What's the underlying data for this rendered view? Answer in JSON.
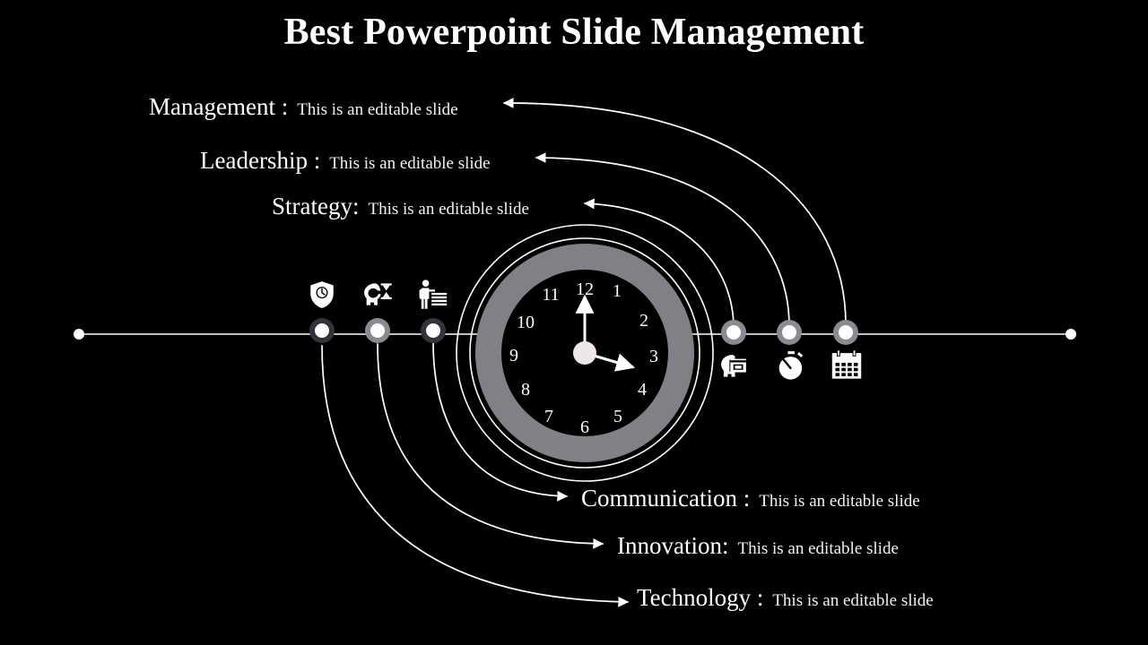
{
  "slide": {
    "title": "Best Powerpoint Slide Management",
    "background_color": "#000000",
    "text_color": "#ffffff",
    "accent_gray": "#808086",
    "marker_dark": "#33333a",
    "marker_light": "#8a8a90"
  },
  "upper_items": [
    {
      "title": "Management :",
      "description": "This is an editable slide",
      "icon": "calendar-head-icon"
    },
    {
      "title": "Leadership :",
      "description": "This is an editable slide",
      "icon": "stopwatch-icon"
    },
    {
      "title": "Strategy:",
      "description": "This is an editable slide",
      "icon": "calendar-icon"
    }
  ],
  "lower_items": [
    {
      "title": "Communication :",
      "description": "This is an editable slide",
      "icon": "shield-clock-icon"
    },
    {
      "title": "Innovation:",
      "description": "This is an editable slide",
      "icon": "head-hourglass-icon"
    },
    {
      "title": "Technology :",
      "description": "This is an editable slide",
      "icon": "person-presenting-icon"
    }
  ],
  "timeline": {
    "left_icons": [
      "shield-clock-icon",
      "head-hourglass-icon",
      "person-presenting-icon"
    ],
    "right_icons": [
      "calendar-head-icon",
      "stopwatch-icon",
      "calendar-icon"
    ],
    "marker_count": 6,
    "endpoint_dots": 2
  },
  "clock": {
    "numbers": [
      "1",
      "2",
      "3",
      "4",
      "5",
      "6",
      "7",
      "8",
      "9",
      "10",
      "11",
      "12"
    ],
    "minute_hand": "12",
    "hour_hand": "4",
    "ring_color": "#808086",
    "face_color": "#000000",
    "hub_color": "#ece6e6"
  }
}
